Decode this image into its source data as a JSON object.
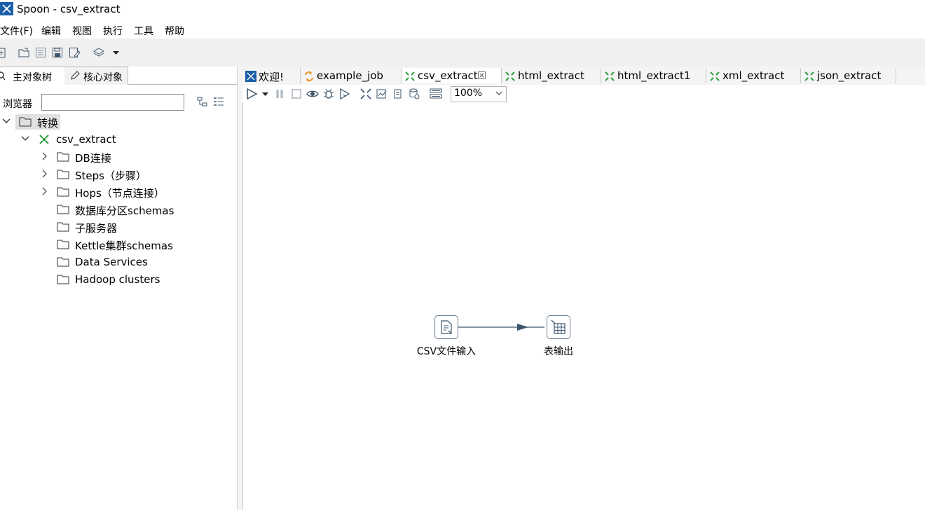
{
  "window": {
    "title": "Spoon - csv_extract"
  },
  "menu": [
    "文件(F)",
    "编辑",
    "视图",
    "执行",
    "工具",
    "帮助"
  ],
  "toolbar_icons": [
    "new-file-icon",
    "open-folder-icon",
    "explore-repository-icon",
    "save-icon",
    "save-as-icon",
    "perspective-layers-icon",
    "dropdown-arrow-icon"
  ],
  "left_panel": {
    "tabs": [
      "主对象树",
      "核心对象"
    ],
    "browser_label": "浏览器",
    "browser_value": "",
    "tree": {
      "root": "转换",
      "transform": "csv_extract",
      "children": [
        "DB连接",
        "Steps（步骤）",
        "Hops（节点连接）",
        "数据库分区schemas",
        "子服务器",
        "Kettle集群schemas",
        "Data Services",
        "Hadoop clusters"
      ]
    }
  },
  "editor_tabs": [
    {
      "label": "欢迎!",
      "icon": "spoon-icon"
    },
    {
      "label": "example_job",
      "icon": "job-icon"
    },
    {
      "label": "csv_extract",
      "icon": "transformation-icon",
      "active": true,
      "closable": true
    },
    {
      "label": "html_extract",
      "icon": "transformation-icon"
    },
    {
      "label": "html_extract1",
      "icon": "transformation-icon"
    },
    {
      "label": "xml_extract",
      "icon": "transformation-icon"
    },
    {
      "label": "json_extract",
      "icon": "transformation-icon"
    }
  ],
  "canvas_toolbar": {
    "zoom": "100%"
  },
  "canvas": {
    "steps": [
      "CSV文件输入",
      "表输出"
    ],
    "hop": {
      "from": "CSV文件输入",
      "to": "表输出"
    }
  },
  "colors": {
    "accent": "#1a5fa8",
    "transform_green": "#2aa13a",
    "job_orange": "#e89420",
    "hop": "#3d556b"
  }
}
